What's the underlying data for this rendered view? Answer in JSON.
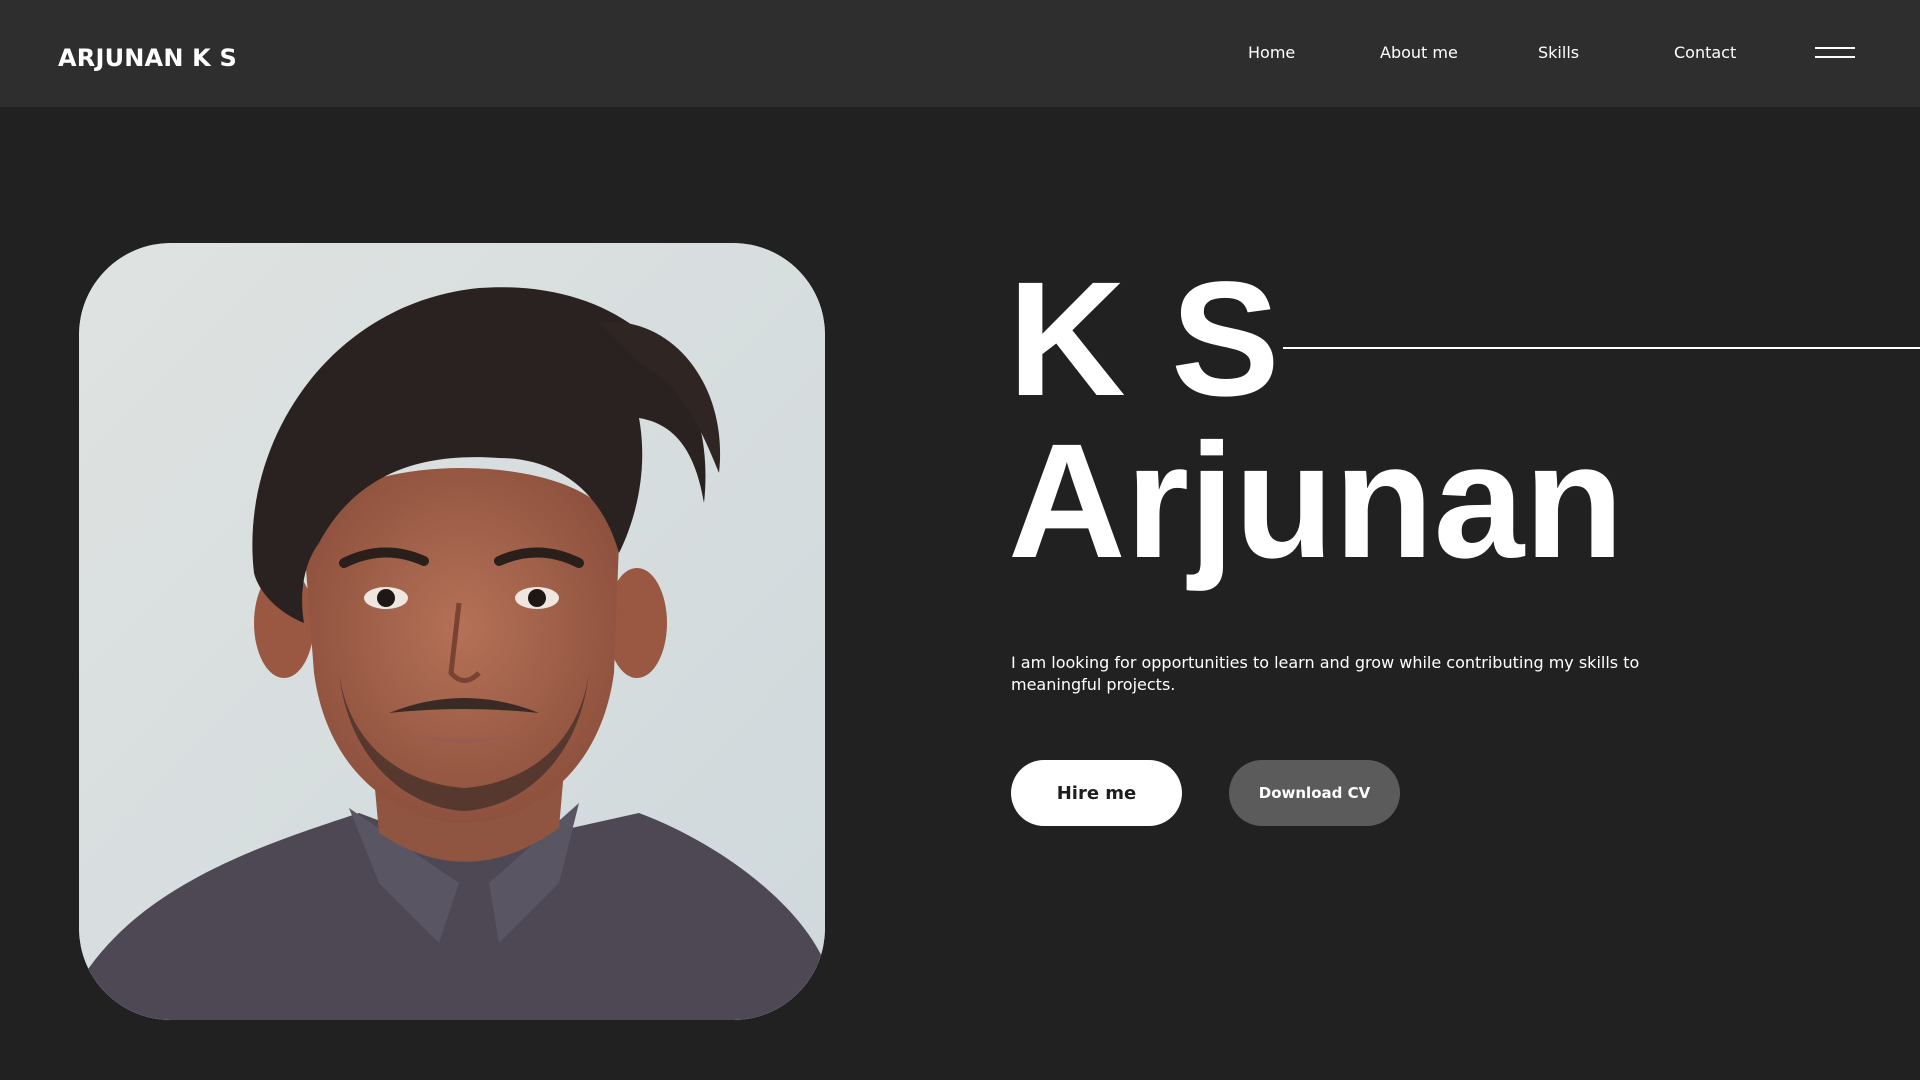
{
  "header": {
    "brand": "ARJUNAN K S",
    "nav": [
      {
        "label": "Home"
      },
      {
        "label": "About me"
      },
      {
        "label": "Skills"
      },
      {
        "label": "Contact"
      }
    ],
    "menu_icon": "hamburger-menu-icon"
  },
  "hero": {
    "name_line1": "K S",
    "name_line2": "Arjunan",
    "tagline": "I am looking for opportunities to learn and grow while contributing my skills to meaningful projects.",
    "buttons": {
      "primary_label": "Hire me",
      "secondary_label": "Download CV"
    }
  },
  "colors": {
    "page_background": "#202120",
    "navbar_background": "#2e2e2e",
    "primary_button": "#ffffff",
    "secondary_button": "#5b5b5b",
    "text": "#ffffff"
  }
}
